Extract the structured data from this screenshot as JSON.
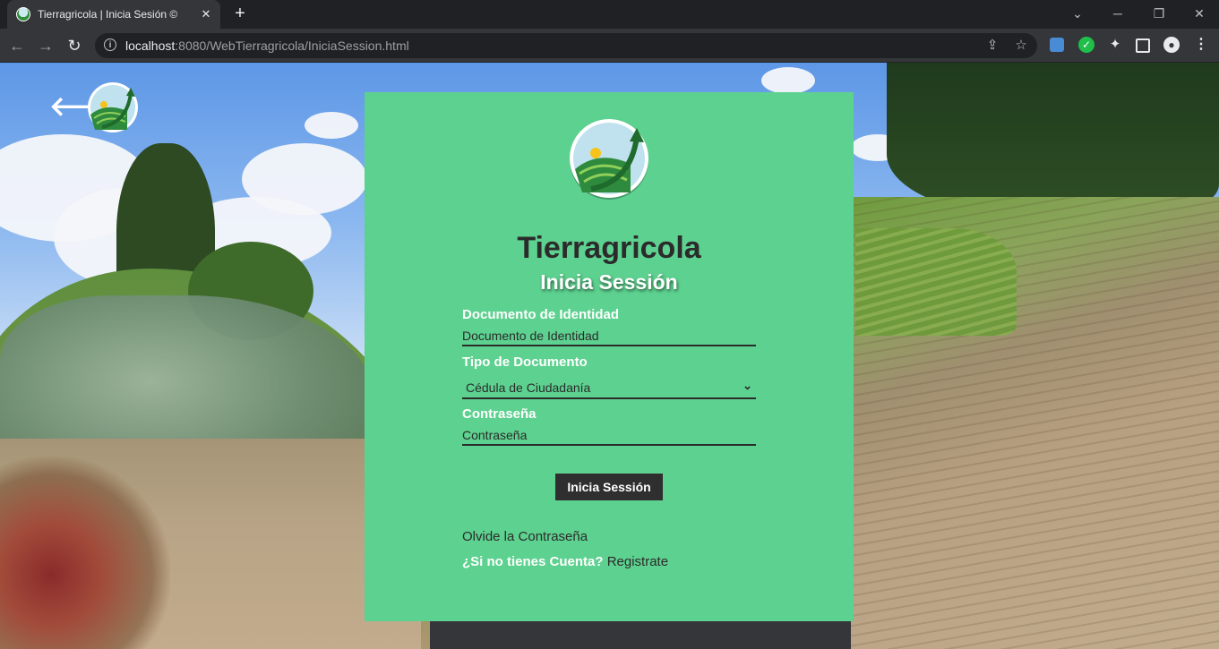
{
  "browser": {
    "tab_title": "Tierragricola | Inicia Sesión ©",
    "tab_close": "✕",
    "new_tab": "+",
    "url_host": "localhost",
    "url_rest": ":8080/WebTierragricola/IniciaSession.html"
  },
  "nav": {
    "back_arrow": "🡐"
  },
  "login": {
    "brand": "Tierragricola",
    "title": "Inicia Sessión",
    "document_label": "Documento de Identidad",
    "document_placeholder": "Documento de Identidad",
    "doc_type_label": "Tipo de Documento",
    "doc_type_selected": "Cédula de Ciudadanía",
    "password_label": "Contraseña",
    "password_placeholder": "Contraseña",
    "submit_label": "Inicia Sessión",
    "forgot_label": "Olvide la Contraseña",
    "no_account_label": "¿Si no tienes Cuenta?",
    "register_label": "Registrate"
  },
  "colors": {
    "card": "#5dd18f",
    "button": "#2f2f2f",
    "brand_text": "#2b2b2b"
  }
}
